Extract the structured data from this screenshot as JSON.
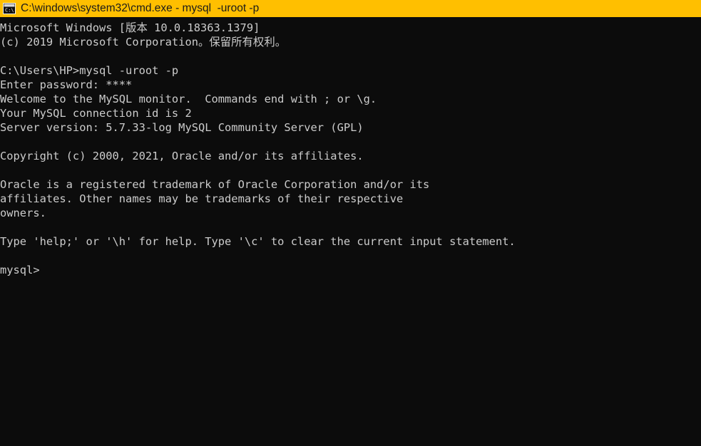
{
  "window": {
    "title": "C:\\windows\\system32\\cmd.exe - mysql  -uroot -p",
    "icon": "cmd-console-icon",
    "titlebar_color": "#ffbf00",
    "titlebar_text_color": "#1a1a1a",
    "background_color": "#0c0c0c",
    "text_color": "#cccccc"
  },
  "console": {
    "lines": [
      "Microsoft Windows [版本 10.0.18363.1379]",
      "(c) 2019 Microsoft Corporation。保留所有权利。",
      "",
      "C:\\Users\\HP>mysql -uroot -p",
      "Enter password: ****",
      "Welcome to the MySQL monitor.  Commands end with ; or \\g.",
      "Your MySQL connection id is 2",
      "Server version: 5.7.33-log MySQL Community Server (GPL)",
      "",
      "Copyright (c) 2000, 2021, Oracle and/or its affiliates.",
      "",
      "Oracle is a registered trademark of Oracle Corporation and/or its",
      "affiliates. Other names may be trademarks of their respective",
      "owners.",
      "",
      "Type 'help;' or '\\h' for help. Type '\\c' to clear the current input statement.",
      "",
      "mysql>"
    ],
    "prompt": "mysql>",
    "os_version": "10.0.18363.1379",
    "copyright_year": "2019",
    "server_version": "5.7.33-log MySQL Community Server (GPL)",
    "connection_id": "2",
    "password_masked": "****",
    "command": "mysql -uroot -p",
    "current_directory": "C:\\Users\\HP"
  }
}
